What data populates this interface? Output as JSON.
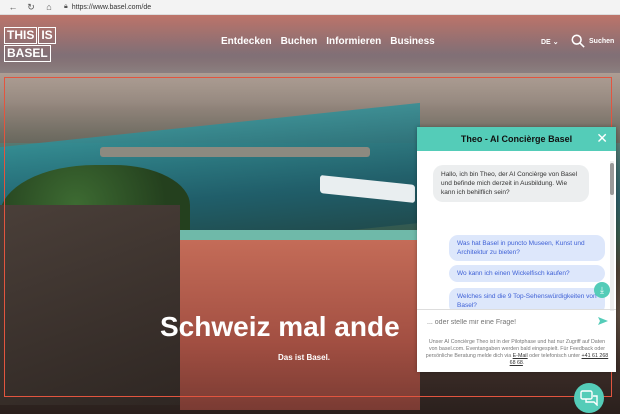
{
  "browser": {
    "url": "https://www.basel.com/de"
  },
  "header": {
    "logo": {
      "line1a": "THIS",
      "line1b": "IS",
      "line2": "BASEL"
    },
    "nav": [
      {
        "label": "Entdecken"
      },
      {
        "label": "Buchen"
      },
      {
        "label": "Informieren"
      },
      {
        "label": "Business"
      }
    ],
    "language": "DE",
    "search_label": "Suchen"
  },
  "hero": {
    "title": "Schweiz mal ande",
    "subtitle": "Das ist Basel."
  },
  "chat": {
    "title": "Theo - AI Concièrge Basel",
    "greeting": "Hallo, ich bin Theo, der AI Concièrge von Basel und befinde mich derzeit in Ausbildung. Wie kann ich behilflich sein?",
    "suggestions": [
      "Was hat Basel in puncto Museen, Kunst und Architektur zu bieten?",
      "Wo kann ich einen Wickelfisch kaufen?",
      "Welches sind die 9 Top-Sehenswürdigkeiten von Basel?"
    ],
    "input_placeholder": "... oder stelle mir eine Frage!",
    "disclaimer_pre": "Unser AI Concièrge Theo ist in der Pilotphase und hat nur Zugriff auf Daten von basel.com. Eventangaben werden bald eingespielt. Für Feedback oder persönliche Beratung melde dich via ",
    "disclaimer_link1": "E-Mail",
    "disclaimer_mid": " oder telefonisch unter ",
    "disclaimer_link2": "+41 61 268 68 68",
    "disclaimer_post": "."
  },
  "colors": {
    "accent": "#54ccb8",
    "frame": "#e2553f",
    "suggestion_text": "#3f61d6"
  }
}
